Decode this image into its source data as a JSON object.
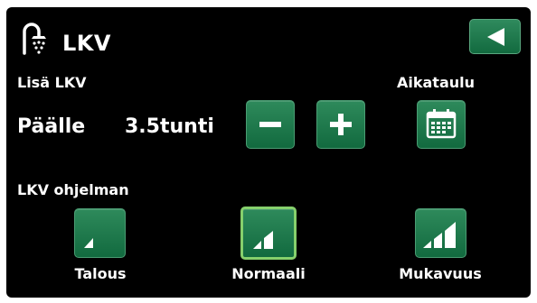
{
  "header": {
    "title": "LKV",
    "icon": "shower-icon",
    "back_icon": "back-arrow-icon"
  },
  "extra_hot_water": {
    "label": "Lisä LKV",
    "state": "Päälle",
    "duration": "3.5tunti",
    "decrease_icon": "minus-icon",
    "increase_icon": "plus-icon"
  },
  "schedule": {
    "label": "Aikataulu",
    "icon": "calendar-icon"
  },
  "program": {
    "label": "LKV ohjelman",
    "options": [
      {
        "label": "Talous",
        "bars": 1
      },
      {
        "label": "Normaali",
        "bars": 2
      },
      {
        "label": "Mukavuus",
        "bars": 3
      }
    ],
    "selected": "Normaali"
  },
  "colors": {
    "button": "#1b7a4b",
    "selected_border": "#86d06c",
    "background": "#000000",
    "text": "#ffffff"
  }
}
